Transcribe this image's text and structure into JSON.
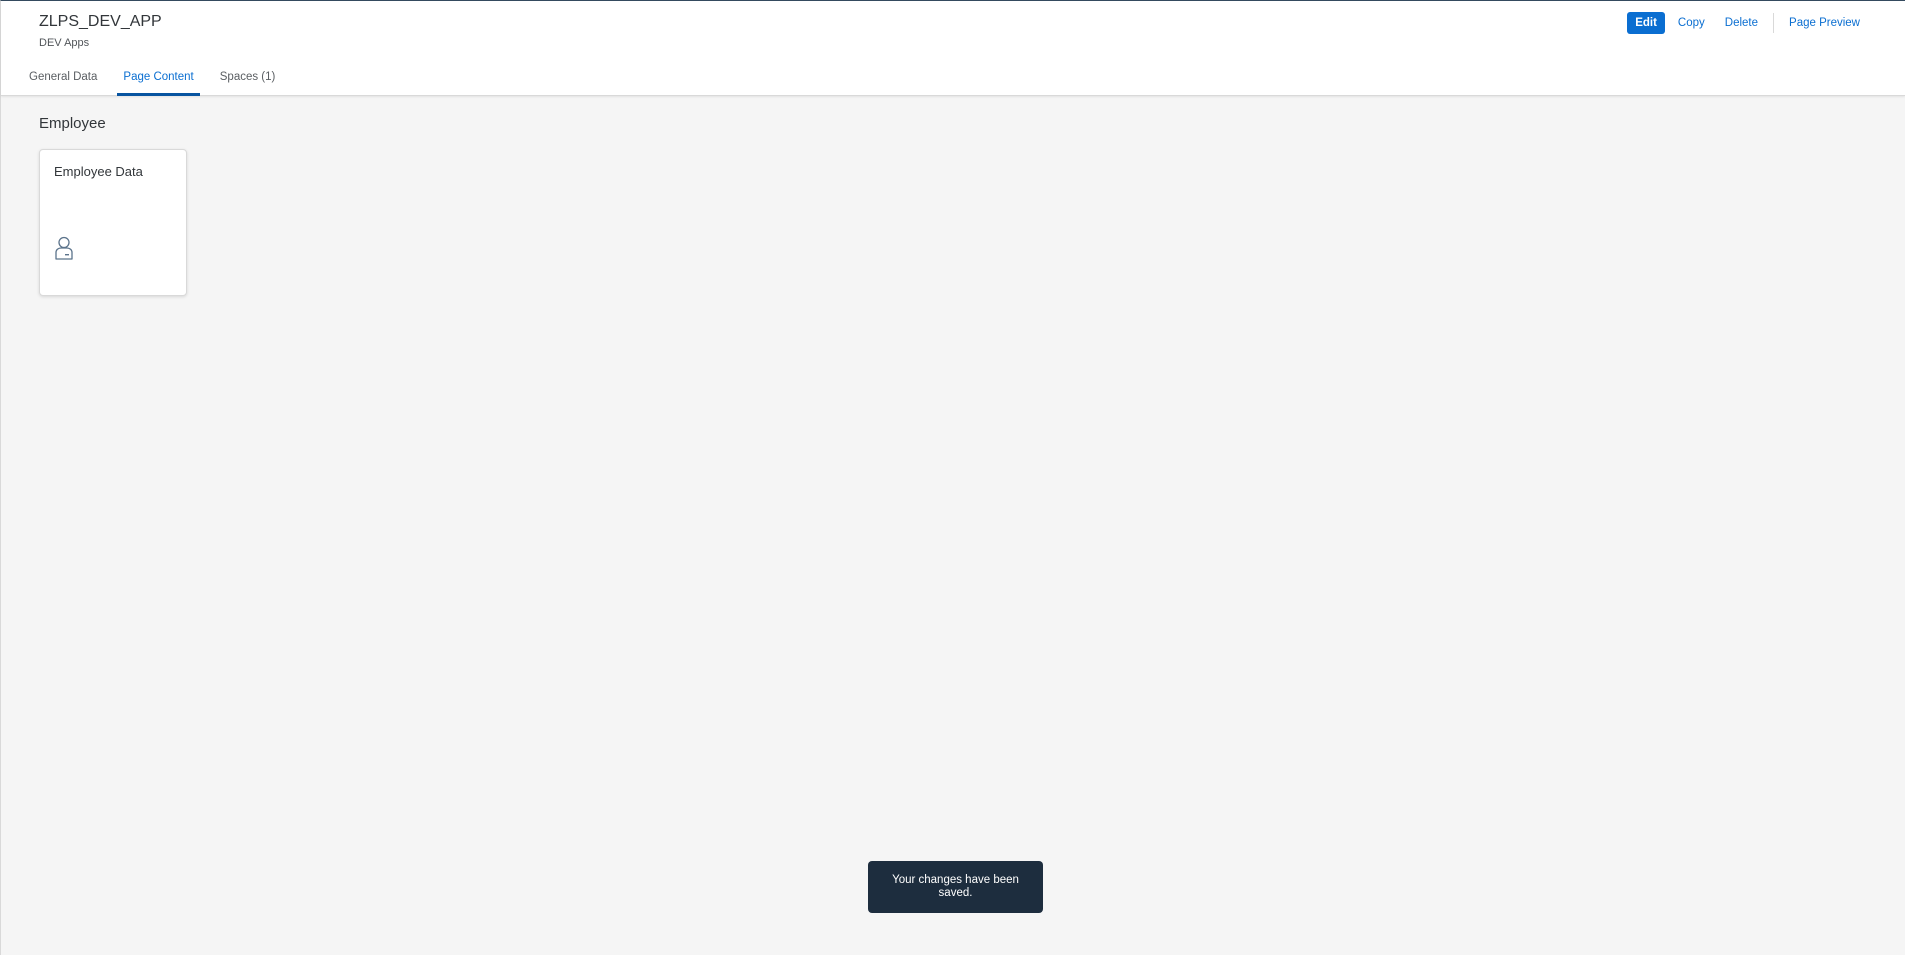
{
  "header": {
    "title": "ZLPS_DEV_APP",
    "subtitle": "DEV Apps",
    "actions": {
      "edit_label": "Edit",
      "copy_label": "Copy",
      "delete_label": "Delete",
      "preview_label": "Page Preview"
    }
  },
  "tabs": [
    {
      "label": "General Data",
      "selected": false
    },
    {
      "label": "Page Content",
      "selected": true
    },
    {
      "label": "Spaces (1)",
      "selected": false
    }
  ],
  "content": {
    "section_title": "Employee",
    "tiles": [
      {
        "title": "Employee Data",
        "icon": "employee-icon"
      }
    ]
  },
  "toast": {
    "message": "Your changes have been saved."
  },
  "colors": {
    "accent": "#0a6ed1",
    "tab_indicator": "#0854a0",
    "toast_background": "#1d2d3e",
    "page_background": "#f5f5f5"
  }
}
